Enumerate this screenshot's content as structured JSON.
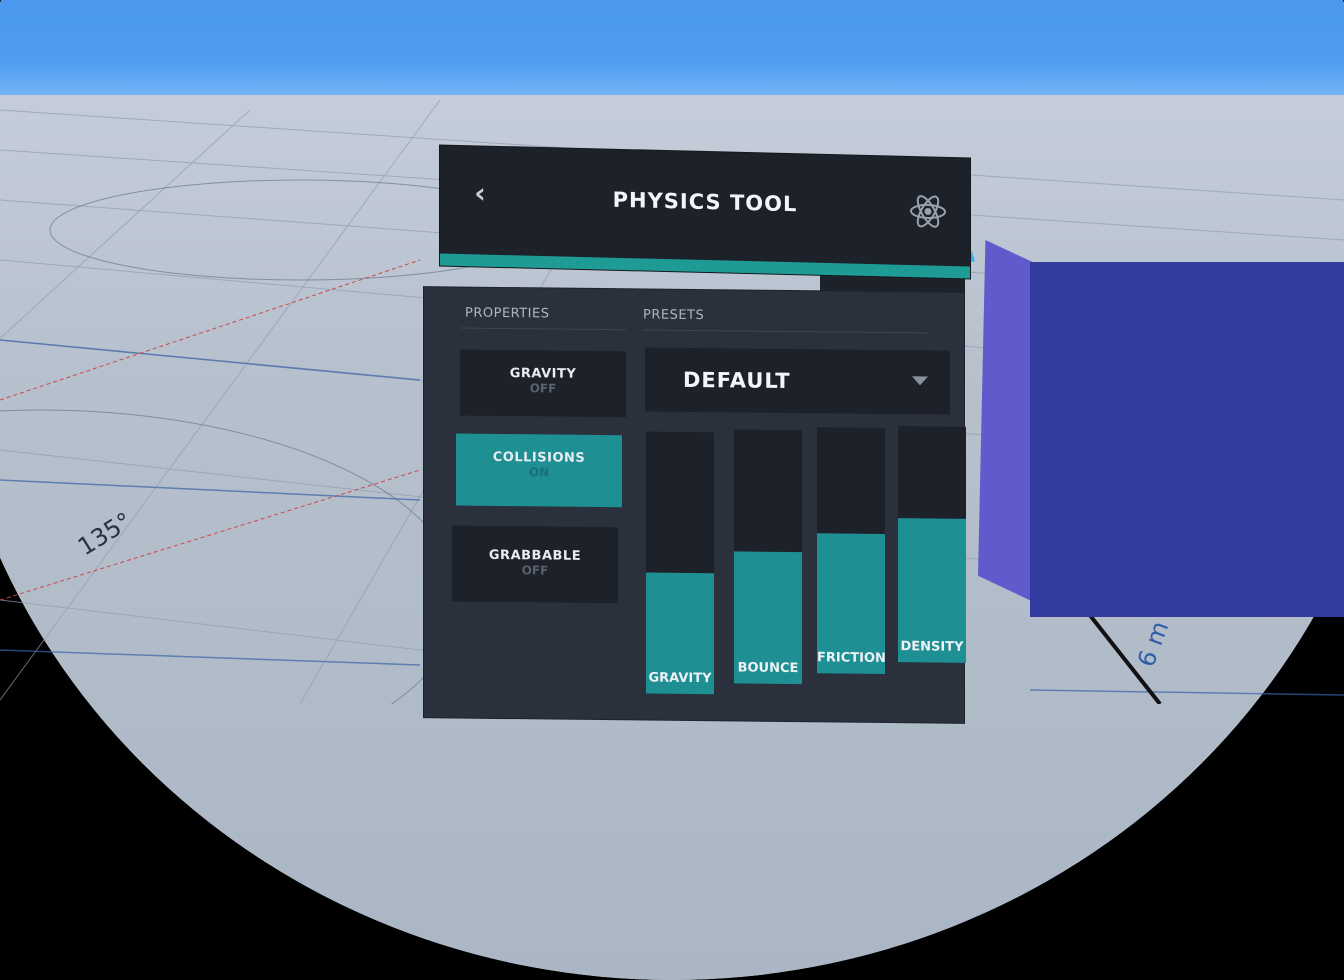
{
  "header": {
    "back_icon": "chevron-left-icon",
    "back_glyph": "‹",
    "title": "PHYSICS TOOL",
    "tool_icon": "atom-icon"
  },
  "panel": {
    "properties_label": "PROPERTIES",
    "presets_label": "PRESETS",
    "properties": [
      {
        "name": "GRAVITY",
        "state": "OFF",
        "active": false
      },
      {
        "name": "COLLISIONS",
        "state": "ON",
        "active": true
      },
      {
        "name": "GRABBABLE",
        "state": "OFF",
        "active": false
      }
    ],
    "preset": {
      "selected": "DEFAULT",
      "icon": "caret-down-icon"
    },
    "sliders": [
      {
        "label": "GRAVITY",
        "level": 0.46
      },
      {
        "label": "BOUNCE",
        "level": 0.52
      },
      {
        "label": "FRICTION",
        "level": 0.57
      },
      {
        "label": "DENSITY",
        "level": 0.61
      }
    ]
  },
  "scene": {
    "angle_label": "135°",
    "distance_label": "6 m"
  },
  "colors": {
    "accent": "#1e8f93",
    "panel": "#2b313c",
    "button": "#1d2129",
    "cube_front": "#333aa0",
    "cube_side": "#5f5bcc"
  }
}
